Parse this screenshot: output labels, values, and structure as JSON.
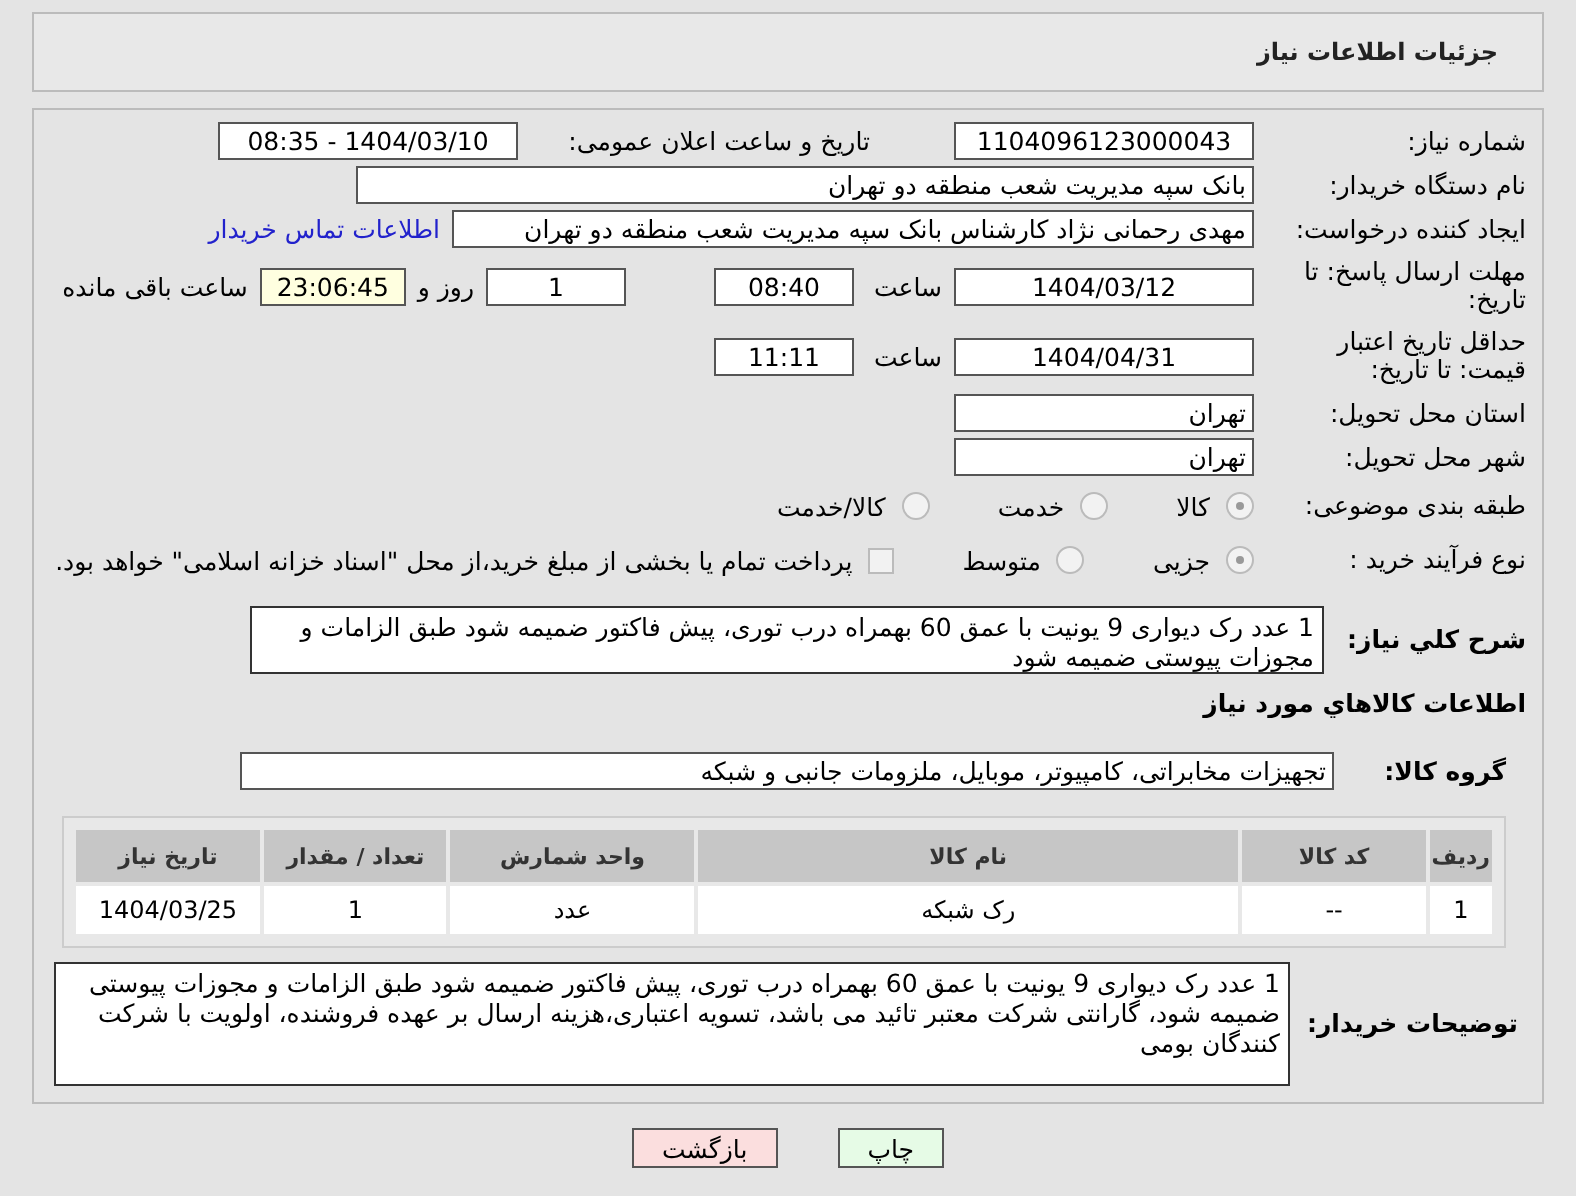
{
  "title": "جزئیات اطلاعات نیاز",
  "need_number": {
    "label": "شماره نیاز:",
    "value": "1104096123000043"
  },
  "announce": {
    "label": "تاریخ و ساعت اعلان عمومی:",
    "value": "1404/03/10 - 08:35"
  },
  "buyer": {
    "label": "نام دستگاه خریدار:",
    "value": "بانک سپه مدیریت شعب منطقه دو تهران"
  },
  "creator": {
    "label": "ایجاد کننده درخواست:",
    "value": "مهدی رحمانی نژاد کارشناس بانک سپه مدیریت شعب منطقه دو تهران",
    "link": "اطلاعات تماس خریدار"
  },
  "deadline": {
    "label": "مهلت ارسال پاسخ: تا تاریخ:",
    "date": "1404/03/12",
    "time_label": "ساعت",
    "time": "08:40",
    "days": "1",
    "days_label": "روز و",
    "remaining": "23:06:45",
    "remaining_label": "ساعت باقی مانده"
  },
  "validity": {
    "label": "حداقل تاریخ اعتبار قیمت: تا تاریخ:",
    "date": "1404/04/31",
    "time_label": "ساعت",
    "time": "11:11"
  },
  "province": {
    "label": "استان محل تحویل:",
    "value": "تهران"
  },
  "city": {
    "label": "شهر محل تحویل:",
    "value": "تهران"
  },
  "category": {
    "label": "طبقه بندی موضوعی:",
    "options": [
      {
        "label": "کالا",
        "selected": true
      },
      {
        "label": "خدمت",
        "selected": false
      },
      {
        "label": "کالا/خدمت",
        "selected": false
      }
    ]
  },
  "process": {
    "label": "نوع فرآیند خرید :",
    "options": [
      {
        "label": "جزیی",
        "selected": true
      },
      {
        "label": "متوسط",
        "selected": false
      }
    ],
    "treasury": {
      "label": "پرداخت تمام یا بخشی از مبلغ خرید،از محل \"اسناد خزانه اسلامی\" خواهد بود.",
      "checked": false
    }
  },
  "description": {
    "label": "شرح كلي نیاز:",
    "value": "1 عدد رک دیواری 9 یونیت با عمق 60 بهمراه درب توری، پیش فاکتور ضمیمه شود طبق الزامات و مجوزات پیوستی ضمیمه شود"
  },
  "goods_heading": "اطلاعات كالاهاي مورد نياز",
  "goods_group": {
    "label": "گروه کالا:",
    "value": "تجهیزات مخابراتی، کامپیوتر، موبایل، ملزومات جانبی و شبکه"
  },
  "table": {
    "columns": [
      "ردیف",
      "کد کالا",
      "نام کالا",
      "واحد شمارش",
      "تعداد / مقدار",
      "تاریخ نیاز"
    ],
    "rows": [
      [
        "1",
        "--",
        "رک شبکه",
        "عدد",
        "1",
        "1404/03/25"
      ]
    ]
  },
  "buyer_notes": {
    "label": "توضیحات خریدار:",
    "value": "1 عدد رک دیواری 9 یونیت با عمق 60 بهمراه درب توری، پیش فاکتور ضمیمه شود طبق الزامات و مجوزات پیوستی ضمیمه شود، گارانتی شرکت معتبر تائید می باشد، تسویه اعتباری،هزینه ارسال بر عهده فروشنده، اولویت با شرکت کنندگان بومی"
  },
  "buttons": [
    {
      "label": "چاپ",
      "kind": "print"
    },
    {
      "label": "بازگشت",
      "kind": "back"
    }
  ]
}
